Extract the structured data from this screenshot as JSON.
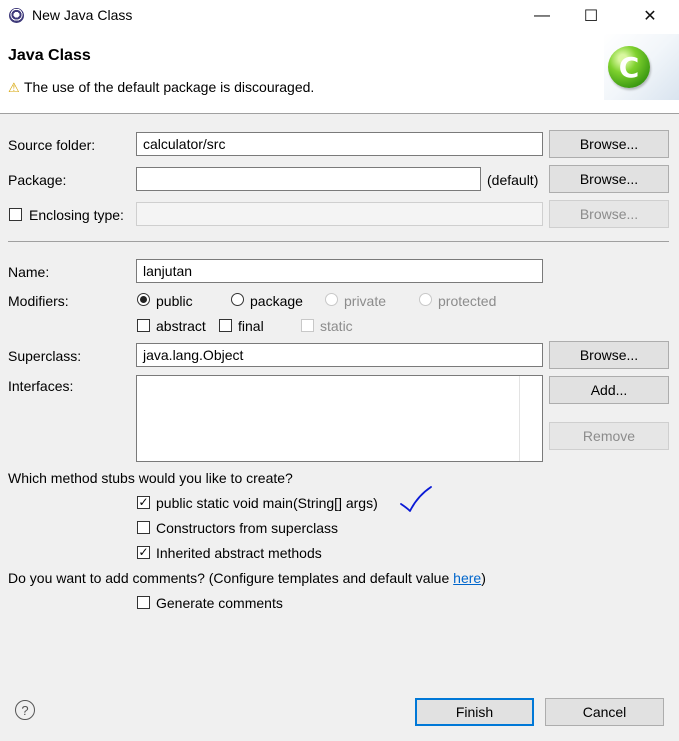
{
  "window": {
    "title": "New Java Class",
    "minimize": "—",
    "maximize": "☐",
    "close": "✕"
  },
  "header": {
    "title": "Java Class",
    "warning_icon": "⚠",
    "message": "The use of the default package is discouraged.",
    "logo_letter": "C"
  },
  "form": {
    "source_folder": {
      "label": "Source folder:",
      "value": "calculator/src",
      "button": "Browse..."
    },
    "package": {
      "label": "Package:",
      "value": "",
      "suffix": "(default)",
      "button": "Browse..."
    },
    "enclosing_type": {
      "label": "Enclosing type:",
      "value": "",
      "button": "Browse..."
    },
    "name": {
      "label": "Name:",
      "value": "lanjutan"
    },
    "modifiers": {
      "label": "Modifiers:",
      "access": [
        "public",
        "package",
        "private",
        "protected"
      ],
      "selected": "public",
      "flags": [
        "abstract",
        "final",
        "static"
      ]
    },
    "superclass": {
      "label": "Superclass:",
      "value": "java.lang.Object",
      "button": "Browse..."
    },
    "interfaces": {
      "label": "Interfaces:",
      "add_button": "Add...",
      "remove_button": "Remove"
    }
  },
  "stubs": {
    "question": "Which method stubs would you like to create?",
    "options": [
      {
        "label": "public static void main(String[] args)",
        "checked": true
      },
      {
        "label": "Constructors from superclass",
        "checked": false
      },
      {
        "label": "Inherited abstract methods",
        "checked": true
      }
    ]
  },
  "comments": {
    "question": "Do you want to add comments? (Configure templates and default value ",
    "link": "here",
    "close_paren": ")",
    "option": "Generate comments"
  },
  "footer": {
    "help": "?",
    "finish": "Finish",
    "cancel": "Cancel"
  },
  "colors": {
    "accent": "#0078d7",
    "link": "#0066cc",
    "annotation": "#0a1ad6"
  }
}
